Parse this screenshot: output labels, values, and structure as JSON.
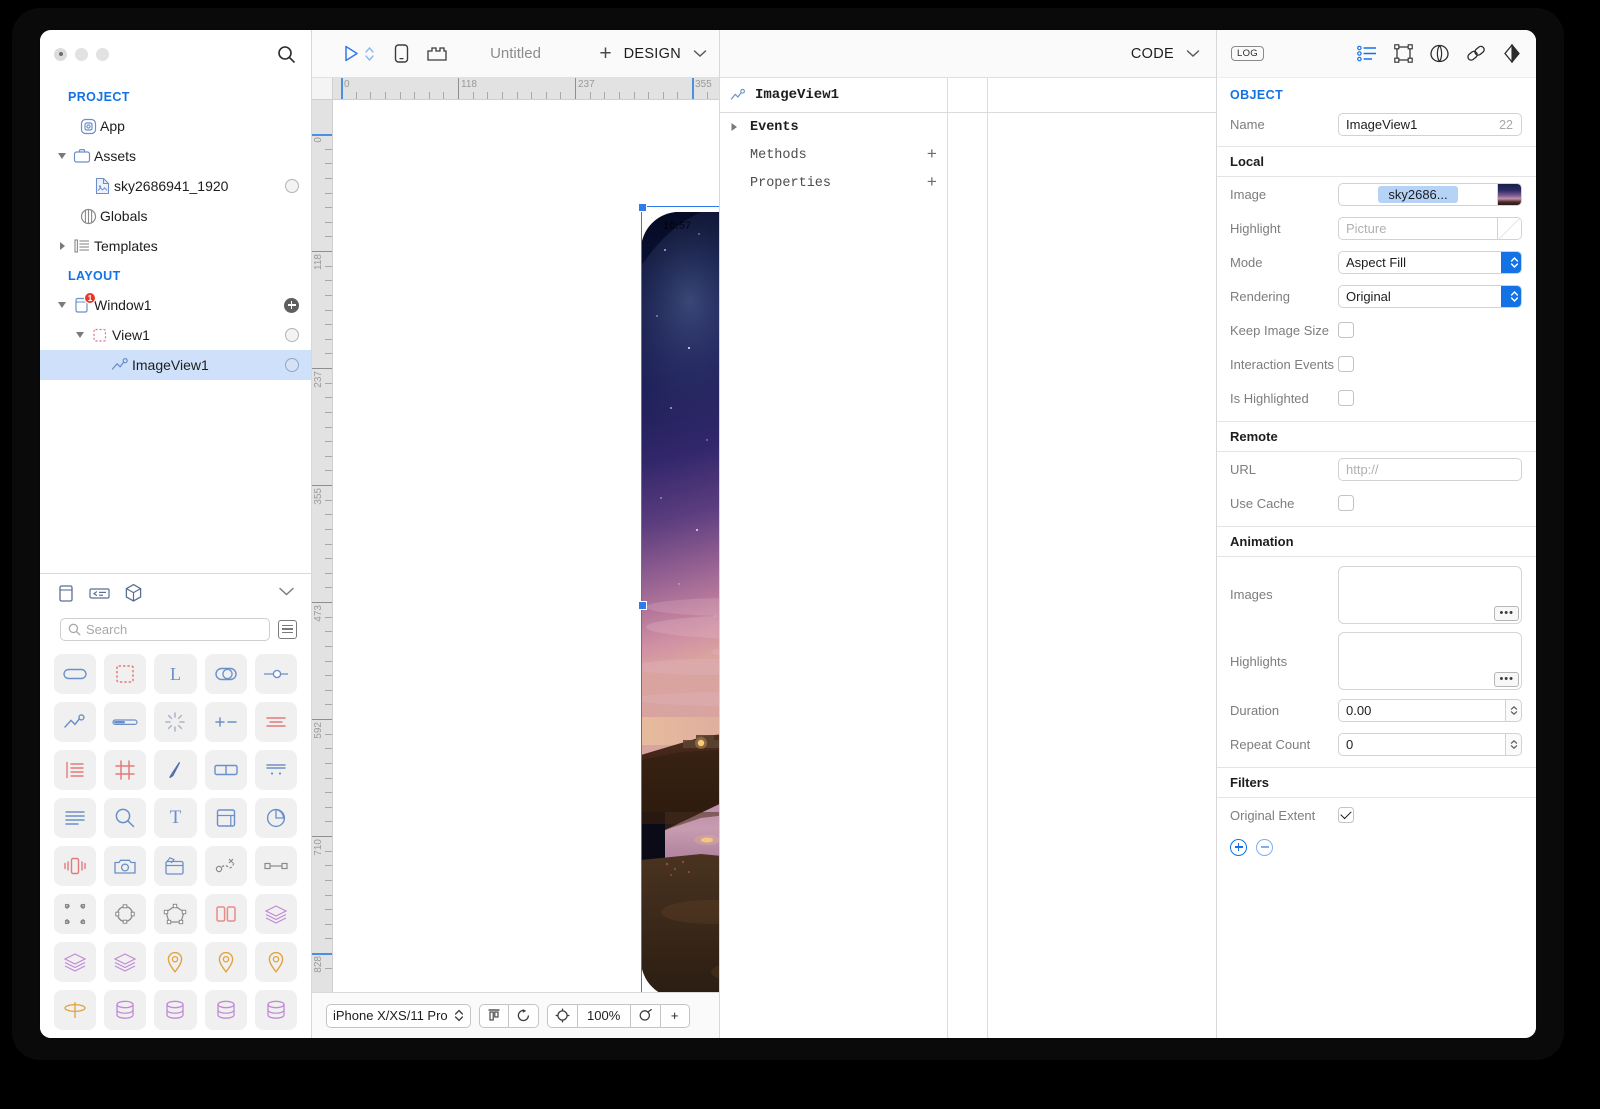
{
  "window": {
    "title": "Untitled"
  },
  "left_sidebar": {
    "search_icon": "search-icon",
    "groups": [
      {
        "label": "PROJECT",
        "items": [
          {
            "label": "App",
            "icon": "app-target-icon",
            "indent": 1,
            "disclosure": "none",
            "trailing": "none"
          },
          {
            "label": "Assets",
            "icon": "briefcase-icon",
            "indent": 1,
            "disclosure": "open",
            "trailing": "none"
          },
          {
            "label": "sky2686941_1920",
            "icon": "image-file-icon",
            "indent": 2,
            "disclosure": "none",
            "trailing": "radio"
          },
          {
            "label": "Globals",
            "icon": "globals-icon",
            "indent": 1,
            "disclosure": "none",
            "trailing": "none"
          },
          {
            "label": "Templates",
            "icon": "templates-icon",
            "indent": 1,
            "disclosure": "closed",
            "trailing": "none"
          }
        ]
      },
      {
        "label": "LAYOUT",
        "items": [
          {
            "label": "Window1",
            "icon": "window-icon",
            "indent": 1,
            "disclosure": "open",
            "trailing": "plus",
            "badge": "1"
          },
          {
            "label": "View1",
            "icon": "view-dashed-icon",
            "indent": 2,
            "disclosure": "open",
            "trailing": "radio"
          },
          {
            "label": "ImageView1",
            "icon": "imageview-icon",
            "indent": 3,
            "disclosure": "none",
            "trailing": "radio-filled",
            "selected": true
          }
        ]
      }
    ]
  },
  "library": {
    "tabs": [
      {
        "name": "tab-views",
        "icon": "view-rect-icon"
      },
      {
        "name": "tab-code-snippets",
        "icon": "code-snippet-icon"
      },
      {
        "name": "tab-objects-3d",
        "icon": "cube-icon"
      }
    ],
    "collapse_icon": "chevron-down-icon",
    "search": {
      "placeholder": "Search",
      "value": ""
    },
    "list_toggle_icon": "list-view-icon",
    "items": [
      {
        "name": "button",
        "icon": "rounded-rect-icon",
        "color": "#6b8fc9"
      },
      {
        "name": "container-view",
        "icon": "dashed-rect-icon",
        "color": "#e27b7b"
      },
      {
        "name": "label",
        "icon": "letter-l-icon",
        "color": "#6b8fc9"
      },
      {
        "name": "switch",
        "icon": "toggle-icon",
        "color": "#6b8fc9"
      },
      {
        "name": "slider",
        "icon": "slider-icon",
        "color": "#6b8fc9"
      },
      {
        "name": "image-view",
        "icon": "imageview-icon",
        "color": "#6b8fc9"
      },
      {
        "name": "progress-bar",
        "icon": "progressbar-icon",
        "color": "#6b8fc9"
      },
      {
        "name": "activity-indicator",
        "icon": "spinner-icon",
        "color": "#aab4c6"
      },
      {
        "name": "stepper",
        "icon": "plus-minus-icon",
        "color": "#6b8fc9"
      },
      {
        "name": "segmented-control",
        "icon": "segment-lines-icon",
        "color": "#e27b7b"
      },
      {
        "name": "table-view",
        "icon": "table-rows-icon",
        "color": "#e27b7b"
      },
      {
        "name": "collection-view",
        "icon": "grid-hash-icon",
        "color": "#e27b7b"
      },
      {
        "name": "web-view",
        "icon": "compass-icon",
        "color": "#6b8fc9"
      },
      {
        "name": "split-view",
        "icon": "split-rect-icon",
        "color": "#6b8fc9"
      },
      {
        "name": "picker-view",
        "icon": "picker-icon",
        "color": "#6b8fc9"
      },
      {
        "name": "text-view",
        "icon": "text-lines-icon",
        "color": "#6b8fc9"
      },
      {
        "name": "search-bar",
        "icon": "search-icon",
        "color": "#6b8fc9"
      },
      {
        "name": "text-field",
        "icon": "letter-t-icon",
        "color": "#6b8fc9"
      },
      {
        "name": "card-view",
        "icon": "card-icon",
        "color": "#6b8fc9"
      },
      {
        "name": "chart-view",
        "icon": "pie-chart-icon",
        "color": "#6b8fc9"
      },
      {
        "name": "vibration",
        "icon": "vibrate-icon",
        "color": "#e27b7b"
      },
      {
        "name": "camera",
        "icon": "camera-icon",
        "color": "#6b8fc9"
      },
      {
        "name": "movie-player",
        "icon": "clapperboard-icon",
        "color": "#6b8fc9"
      },
      {
        "name": "motion-sensor",
        "icon": "motion-axes-icon",
        "color": "#8a8a8a"
      },
      {
        "name": "node-link",
        "icon": "node-link-icon",
        "color": "#8a8a8a"
      },
      {
        "name": "bounding-box",
        "icon": "bounding-box-icon",
        "color": "#8a8a8a"
      },
      {
        "name": "anchor-circle",
        "icon": "anchor-circle-icon",
        "color": "#8a8a8a"
      },
      {
        "name": "polygon-nodes",
        "icon": "polygon-nodes-icon",
        "color": "#8a8a8a"
      },
      {
        "name": "dual-pane",
        "icon": "dual-pane-icon",
        "color": "#e88b8b"
      },
      {
        "name": "layer-stack-1",
        "icon": "layers-icon",
        "color": "#c08ad4"
      },
      {
        "name": "layer-stack-2",
        "icon": "layers-icon",
        "color": "#c08ad4"
      },
      {
        "name": "layer-stack-3",
        "icon": "layers-icon",
        "color": "#c08ad4"
      },
      {
        "name": "map-pin-1",
        "icon": "map-pin-icon",
        "color": "#e0a33f"
      },
      {
        "name": "map-pin-2",
        "icon": "map-pin-icon",
        "color": "#e0a33f"
      },
      {
        "name": "map-pin-3",
        "icon": "map-pin-icon",
        "color": "#e0a33f"
      },
      {
        "name": "orbit",
        "icon": "orbit-icon",
        "color": "#e0a33f"
      },
      {
        "name": "database-1",
        "icon": "database-icon",
        "color": "#c08ad4"
      },
      {
        "name": "database-2",
        "icon": "database-icon",
        "color": "#c08ad4"
      },
      {
        "name": "database-3",
        "icon": "database-icon",
        "color": "#c08ad4"
      },
      {
        "name": "database-4",
        "icon": "database-icon",
        "color": "#c08ad4"
      }
    ]
  },
  "center": {
    "toolbar": {
      "run_icon": "play-icon",
      "run_options_icon": "up-down-chevrons-icon",
      "device_icon": "phone-icon",
      "layout_icon": "layout-blocks-icon",
      "add_label": "+",
      "mode_label": "DESIGN",
      "mode_chevron": "chevron-down-icon"
    },
    "ruler": {
      "h_labels": [
        "0",
        "118",
        "237",
        "355"
      ],
      "v_labels": [
        "0",
        "118",
        "237",
        "355",
        "473",
        "592",
        "710",
        "828"
      ]
    },
    "device_status": {
      "time": "10:57"
    },
    "bottom": {
      "device_label": "iPhone X/XS/11 Pro",
      "device_chevron": "up-down-chevrons-icon",
      "align_icon": "align-top-icon",
      "rotate_icon": "rotate-icon",
      "center_icon": "center-target-icon",
      "zoom_label": "100%",
      "zoom_out_icon": "zoom-out-icon",
      "zoom_in_label": "+"
    }
  },
  "mid": {
    "toolbar": {
      "mode_label": "CODE",
      "mode_chevron": "chevron-down-icon"
    },
    "header": {
      "icon": "imageview-icon",
      "title": "ImageView1"
    },
    "rows": [
      {
        "label": "Events",
        "disclosure": "closed",
        "trailing": ""
      },
      {
        "label": "Methods",
        "disclosure": "none",
        "trailing": "+"
      },
      {
        "label": "Properties",
        "disclosure": "none",
        "trailing": "+"
      }
    ]
  },
  "right": {
    "toolbar": {
      "log_label": "LOG",
      "icons": [
        {
          "name": "properties-list-icon"
        },
        {
          "name": "layout-frame-icon"
        },
        {
          "name": "appearance-icon"
        },
        {
          "name": "link-icon"
        },
        {
          "name": "mirror-icon"
        }
      ]
    },
    "object_title": "OBJECT",
    "name_row": {
      "label": "Name",
      "value": "ImageView1",
      "suffix": "22"
    },
    "sections": [
      {
        "title": "Local",
        "rows": [
          {
            "label": "Image",
            "type": "image-chip",
            "value": "sky2686...",
            "swatch": "image"
          },
          {
            "label": "Highlight",
            "type": "image-chip",
            "value": "",
            "placeholder": "Picture",
            "swatch": "empty"
          },
          {
            "label": "Mode",
            "type": "popup",
            "value": "Aspect Fill"
          },
          {
            "label": "Rendering",
            "type": "popup",
            "value": "Original"
          },
          {
            "label": "Keep Image Size",
            "type": "checkbox",
            "checked": false
          },
          {
            "label": "Interaction Events",
            "type": "checkbox",
            "checked": false
          },
          {
            "label": "Is Highlighted",
            "type": "checkbox",
            "checked": false
          }
        ]
      },
      {
        "title": "Remote",
        "rows": [
          {
            "label": "URL",
            "type": "text",
            "value": "",
            "placeholder": "http://"
          },
          {
            "label": "Use Cache",
            "type": "checkbox",
            "checked": false
          }
        ]
      },
      {
        "title": "Animation",
        "rows": [
          {
            "label": "Images",
            "type": "bigbox",
            "value": "",
            "ellipsis": "•••"
          },
          {
            "label": "Highlights",
            "type": "bigbox",
            "value": "",
            "ellipsis": "•••"
          },
          {
            "label": "Duration",
            "type": "stepper",
            "value": "0.00"
          },
          {
            "label": "Repeat Count",
            "type": "stepper",
            "value": "0"
          }
        ]
      },
      {
        "title": "Filters",
        "rows": [
          {
            "label": "Original Extent",
            "type": "checkbox",
            "checked": true
          },
          {
            "label": "",
            "type": "addremove",
            "add": "+",
            "remove": "-"
          }
        ]
      }
    ]
  },
  "colors": {
    "accent_blue": "#1373e6",
    "selection_blue": "#2f7bea",
    "tree_selected_bg": "#cfe1fa",
    "chip_bg": "#b4d3f7",
    "badge_red": "#e8372b"
  }
}
